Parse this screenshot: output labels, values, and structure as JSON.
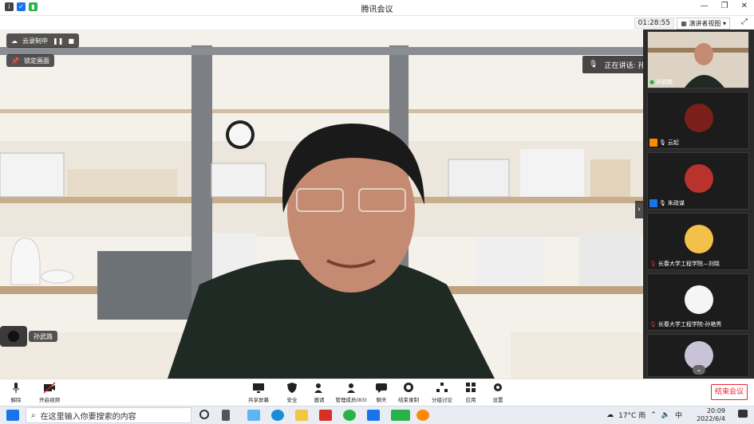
{
  "window": {
    "title": "腾讯会议"
  },
  "top_bar": {
    "timer": "01:28:55",
    "view_mode": "演讲者视图",
    "view_caret": "▾"
  },
  "overlays": {
    "recording_label": "云录制中",
    "pin_label": "锁定画面",
    "speaking_label": "正在讲话: 孙武略",
    "self_name": "孙武路"
  },
  "participants": [
    {
      "name": "孙武略"
    },
    {
      "name": "云起"
    },
    {
      "name": "朱政谋"
    },
    {
      "name": "长春大学工程学院—刘晓"
    },
    {
      "name": "长春大学工程学院-孙艳秀"
    },
    {
      "name": ""
    }
  ],
  "toolbar": {
    "mute_label": "解除",
    "video_label": "开启视频",
    "share_label": "共享屏幕",
    "security_label": "安全",
    "invite_label": "邀请",
    "members_label": "管理成员(83)",
    "chat_label": "聊天",
    "record_label": "结束录制",
    "breakout_label": "分组讨论",
    "apps_label": "应用",
    "settings_label": "设置",
    "end_label": "结束会议"
  },
  "taskbar": {
    "search_placeholder": "在这里输入你要搜索的内容",
    "weather": "17°C 雨",
    "lang": "中",
    "time": "20:09",
    "date": "2022/6/4"
  },
  "colors": {
    "accent_blue": "#1a73e8",
    "end_red": "#e22233",
    "orange_badge": "#ff8a00"
  }
}
